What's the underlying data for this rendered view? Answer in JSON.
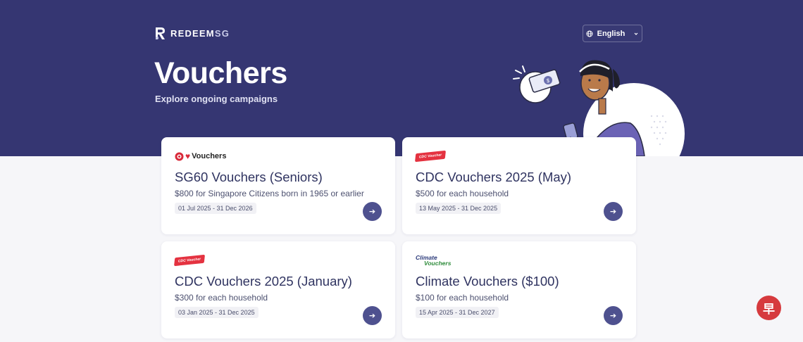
{
  "header": {
    "logo_prefix": "REDEEM",
    "logo_suffix": "SG",
    "language_label": "English",
    "title": "Vouchers",
    "subtitle": "Explore ongoing campaigns"
  },
  "cards": [
    {
      "brand_text": "Vouchers",
      "title": "SG60 Vouchers (Seniors)",
      "description": "$800 for Singapore Citizens born in 1965 or earlier",
      "dates": "01 Jul 2025 - 31 Dec 2026"
    },
    {
      "brand_text": "CDC Voucher",
      "title": "CDC Vouchers 2025 (May)",
      "description": "$500 for each household",
      "dates": "13 May 2025 - 31 Dec 2025"
    },
    {
      "brand_text": "CDC Voucher",
      "title": "CDC Vouchers 2025 (January)",
      "description": "$300 for each household",
      "dates": "03 Jan 2025 - 31 Dec 2025"
    },
    {
      "brand_text_1": "Climate",
      "brand_text_2": "Vouchers",
      "title": "Climate Vouchers ($100)",
      "description": "$100 for each household",
      "dates": "15 Apr 2025 - 31 Dec 2027"
    }
  ],
  "colors": {
    "hero_bg": "#353672",
    "page_bg": "#f6f6f9",
    "card_title": "#2f3360",
    "action_button": "#4e518f",
    "cdc_red": "#e43240"
  },
  "icons": {
    "language": "globe-icon",
    "dropdown": "chevron-down-icon",
    "card_action": "arrow-right-icon"
  }
}
